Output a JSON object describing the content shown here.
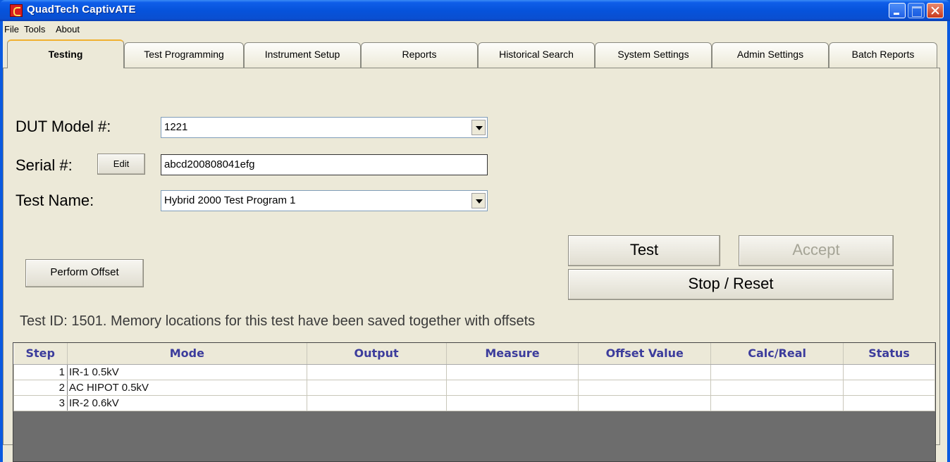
{
  "window": {
    "title": "QuadTech CaptivATE"
  },
  "menu": [
    "File",
    "Tools",
    "About"
  ],
  "tabs": [
    "Testing",
    "Test Programming",
    "Instrument Setup",
    "Reports",
    "Historical Search",
    "System Settings",
    "Admin Settings",
    "Batch Reports"
  ],
  "active_tab": "Testing",
  "form": {
    "dut_model_label": "DUT Model #:",
    "dut_model_value": "1221",
    "serial_label": "Serial #:",
    "serial_edit_button": "Edit",
    "serial_value": "abcd200808041efg",
    "test_name_label": "Test Name:",
    "test_name_value": "Hybrid 2000 Test Program 1"
  },
  "buttons": {
    "test": "Test",
    "accept": "Accept",
    "stop_reset": "Stop / Reset",
    "perform_offset": "Perform Offset"
  },
  "status_message": "Test ID: 1501. Memory locations for this test have been saved together with offsets",
  "grid": {
    "columns": [
      "Step",
      "Mode",
      "Output",
      "Measure",
      "Offset Value",
      "Calc/Real",
      "Status"
    ],
    "rows": [
      {
        "step": "1",
        "mode": "IR-1 0.5kV",
        "output": "",
        "measure": "",
        "offset": "",
        "calc": "",
        "status": ""
      },
      {
        "step": "2",
        "mode": "AC HIPOT 0.5kV",
        "output": "",
        "measure": "",
        "offset": "",
        "calc": "",
        "status": ""
      },
      {
        "step": "3",
        "mode": "IR-2 0.6kV",
        "output": "",
        "measure": "",
        "offset": "",
        "calc": "",
        "status": ""
      }
    ]
  },
  "colors": {
    "titlebar": "#0653db",
    "face": "#ece9d8",
    "grid_header_text": "#3c3c9c",
    "active_tab_accent": "#f0b030"
  }
}
